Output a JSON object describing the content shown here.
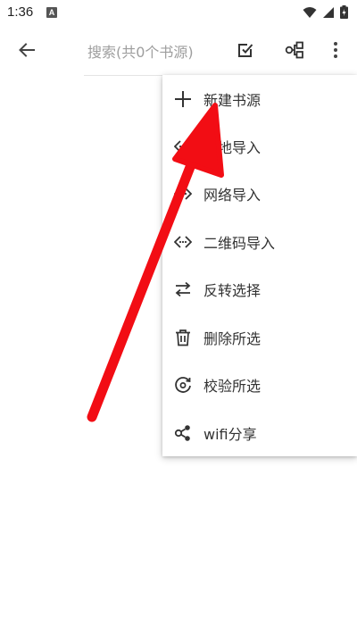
{
  "status_bar": {
    "time": "1:36",
    "notification_icon": "a-icon",
    "icons": [
      "wifi-icon",
      "signal-icon",
      "battery-icon"
    ]
  },
  "toolbar": {
    "back_icon": "arrow-left-icon",
    "search_placeholder": "搜索(共0个书源)",
    "check_icon": "select-check-icon",
    "group_icon": "group-icon",
    "more_icon": "more-vert-icon"
  },
  "menu": {
    "items": [
      {
        "label": "新建书源",
        "icon": "plus-icon"
      },
      {
        "label": "本地导入",
        "icon": "import-icon"
      },
      {
        "label": "网络导入",
        "icon": "import-icon"
      },
      {
        "label": "二维码导入",
        "icon": "import-icon"
      },
      {
        "label": "反转选择",
        "icon": "swap-icon"
      },
      {
        "label": "删除所选",
        "icon": "trash-icon"
      },
      {
        "label": "校验所选",
        "icon": "verify-icon"
      },
      {
        "label": "wifi分享",
        "icon": "share-icon"
      }
    ]
  },
  "colors": {
    "annotation_arrow": "#f20d14",
    "icon": "#333333",
    "placeholder": "#9e9e9e"
  }
}
